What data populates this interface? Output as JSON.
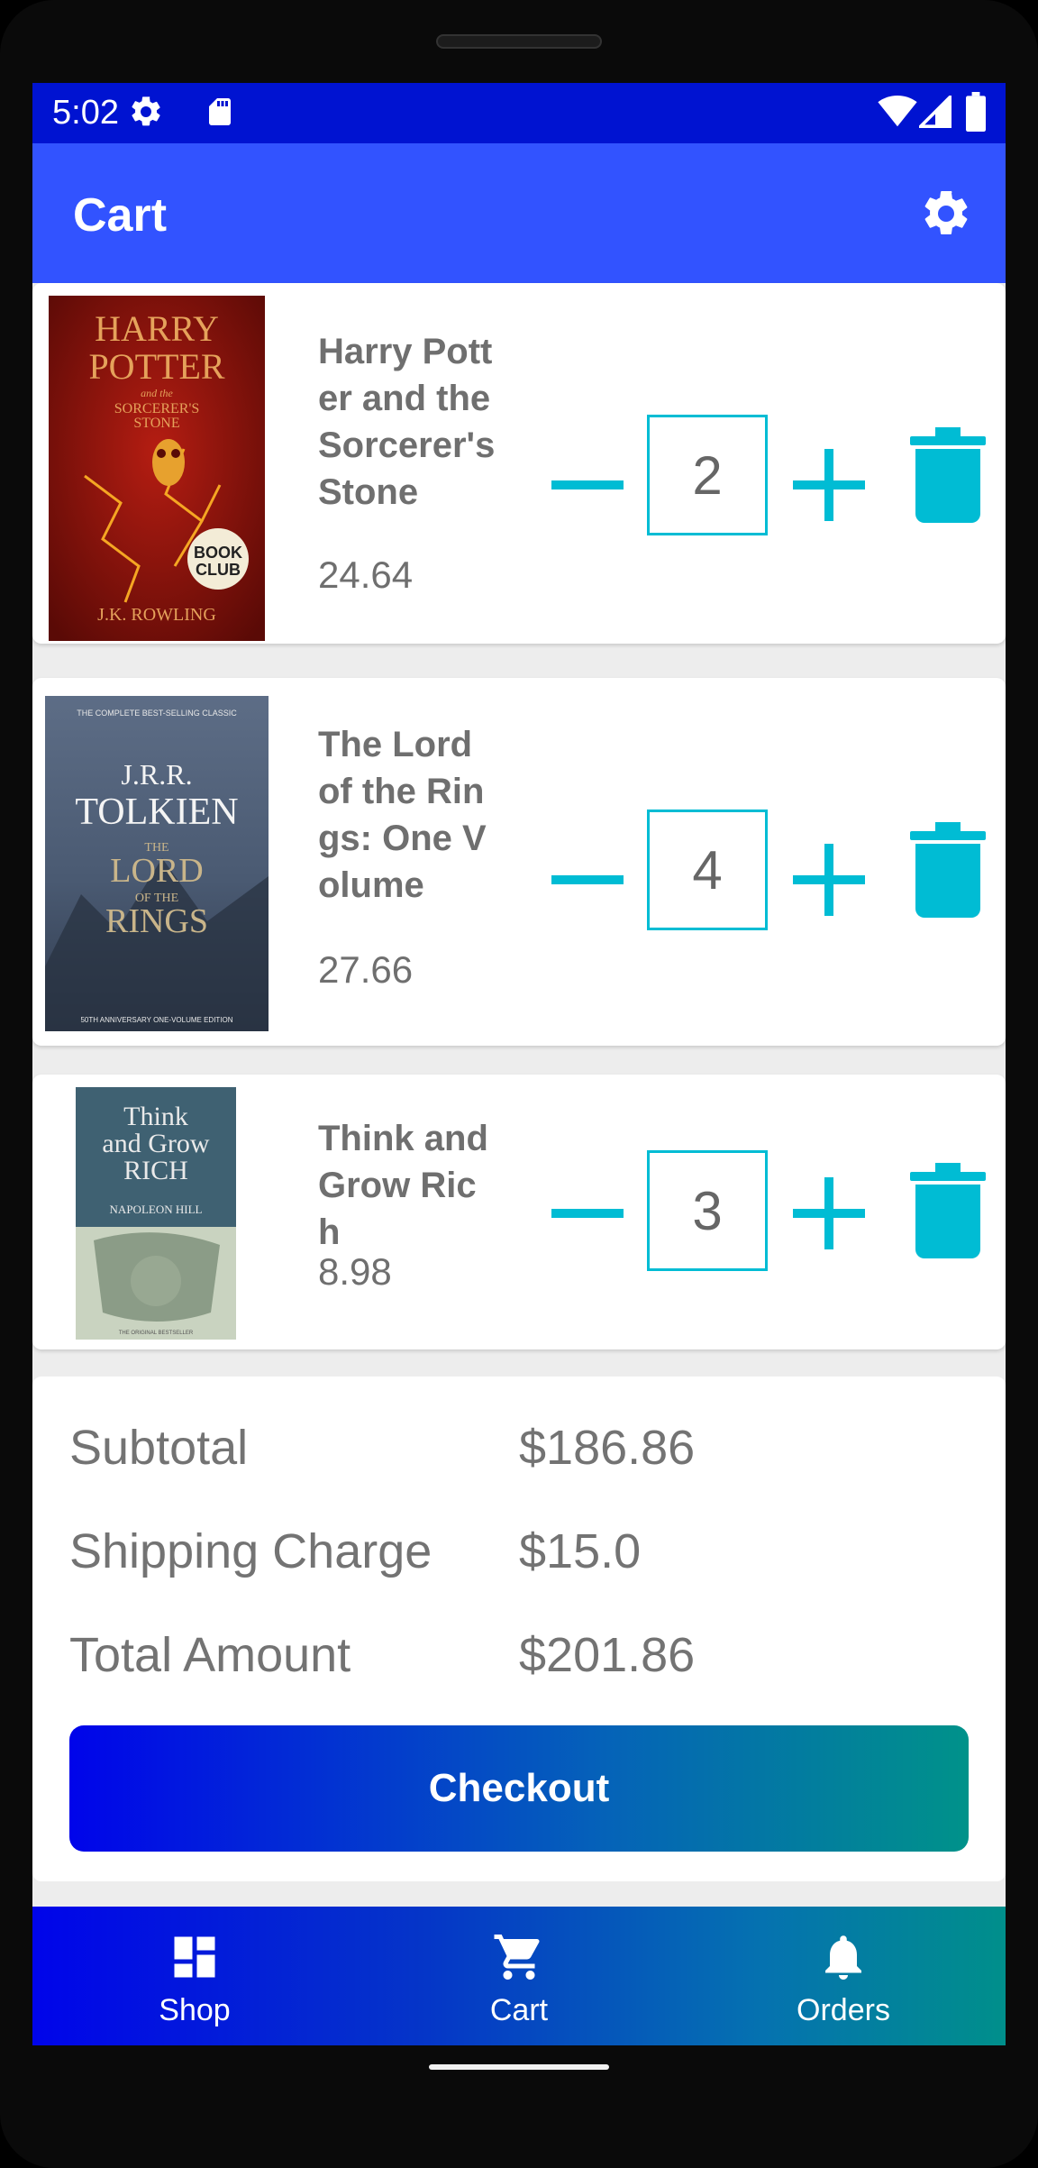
{
  "status_bar": {
    "time": "5:02"
  },
  "app_bar": {
    "title": "Cart"
  },
  "cart_items": [
    {
      "title": "Harry Potter and the Sorcerer's Stone",
      "price": "24.64",
      "quantity": "2",
      "cover": {
        "line1": "HARRY",
        "line2": "POTTER",
        "sub1": "and the",
        "sub2": "SORCERER'S",
        "sub3": "STONE",
        "badge1": "BOOK",
        "badge2": "CLUB",
        "author": "J.K. ROWLING"
      }
    },
    {
      "title": "The Lord of the Rings: One Volume",
      "price": "27.66",
      "quantity": "4",
      "cover": {
        "top": "THE COMPLETE BEST-SELLING CLASSIC",
        "author1": "J.R.R.",
        "author2": "TOLKIEN",
        "t1": "THE",
        "t2": "LORD",
        "t3": "OF THE",
        "t4": "RINGS",
        "bottom": "50TH ANNIVERSARY ONE-VOLUME EDITION"
      }
    },
    {
      "title": "Think and Grow Rich",
      "price": "8.98",
      "quantity": "3",
      "cover": {
        "t1": "Think",
        "t2": "and Grow",
        "t3": "RICH",
        "author": "NAPOLEON HILL",
        "bottom": "THE ORIGINAL BESTSELLER"
      }
    }
  ],
  "summary": {
    "subtotal_label": "Subtotal",
    "subtotal_value": "$186.86",
    "shipping_label": "Shipping Charge",
    "shipping_value": "$15.0",
    "total_label": "Total Amount",
    "total_value": "$201.86",
    "checkout_label": "Checkout"
  },
  "bottom_nav": [
    {
      "label": "Shop",
      "icon": "dashboard-icon"
    },
    {
      "label": "Cart",
      "icon": "cart-icon"
    },
    {
      "label": "Orders",
      "icon": "bell-icon"
    }
  ],
  "colors": {
    "accent": "#00bcd4",
    "appbar": "#3253ff",
    "statusbar": "#0013d1"
  }
}
